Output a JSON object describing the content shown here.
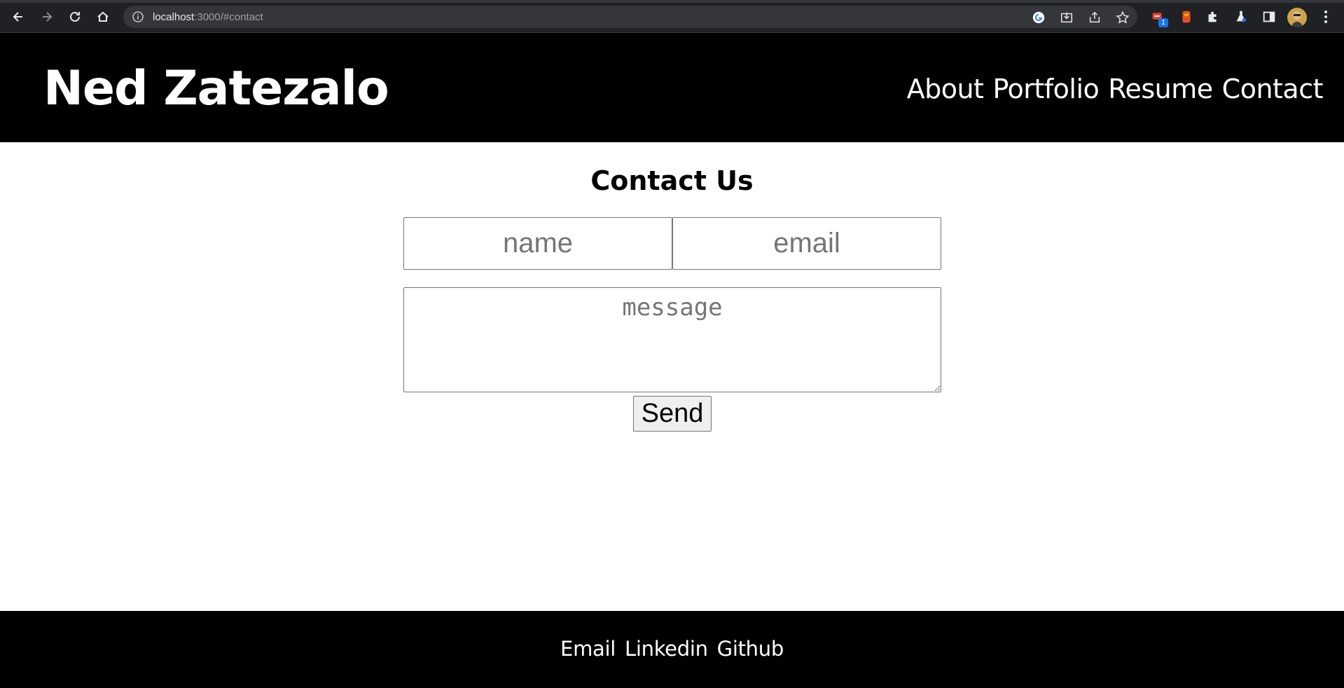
{
  "browser": {
    "url_host": "localhost",
    "url_rest": ":3000/#contact",
    "extension_badge": "1",
    "icons": [
      "back-icon",
      "forward-icon",
      "reload-icon",
      "home-icon",
      "site-info-icon",
      "google-icon",
      "install-icon",
      "share-icon",
      "bookmark-star-icon",
      "extension-icon",
      "puzzle-icon",
      "labs-icon",
      "side-panel-icon",
      "avatar",
      "menu-icon"
    ]
  },
  "header": {
    "title": "Ned Zatezalo",
    "nav": [
      {
        "label": "About"
      },
      {
        "label": "Portfolio"
      },
      {
        "label": "Resume"
      },
      {
        "label": "Contact"
      }
    ]
  },
  "contact": {
    "title": "Contact Us",
    "name_placeholder": "name",
    "email_placeholder": "email",
    "message_placeholder": "message",
    "send_label": "Send"
  },
  "footer": {
    "links": [
      {
        "label": "Email"
      },
      {
        "label": "Linkedin"
      },
      {
        "label": "Github"
      }
    ]
  },
  "colors": {
    "header_bg": "#000000",
    "footer_bg": "#000000",
    "chrome_bg": "#202124"
  }
}
